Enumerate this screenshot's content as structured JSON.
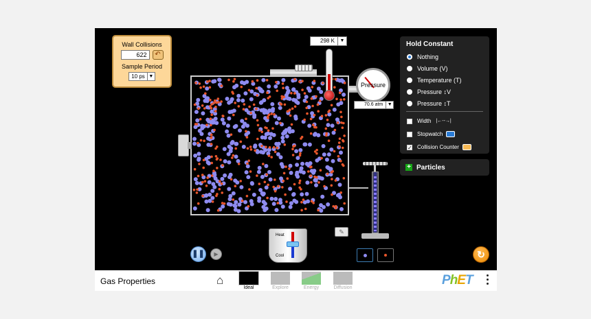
{
  "collision_panel": {
    "title": "Wall Collisions",
    "count": "622",
    "reset_icon": "undo-icon",
    "sample_label": "Sample Period",
    "sample_value": "10 ps"
  },
  "thermometer": {
    "value": "298 K"
  },
  "gauge": {
    "label": "Pressure",
    "value": "70.6 atm"
  },
  "hold_constant": {
    "title": "Hold Constant",
    "options": [
      {
        "label": "Nothing",
        "selected": true
      },
      {
        "label": "Volume (V)",
        "selected": false
      },
      {
        "label": "Temperature (T)",
        "selected": false
      },
      {
        "label": "Pressure ↕V",
        "selected": false
      },
      {
        "label": "Pressure ↕T",
        "selected": false
      }
    ],
    "checks": [
      {
        "label": "Width",
        "suffix": "|←--→|",
        "checked": false
      },
      {
        "label": "Stopwatch",
        "checked": false,
        "icon": "stopwatch-icon"
      },
      {
        "label": "Collision Counter",
        "checked": true,
        "icon": "collision-counter-icon"
      }
    ]
  },
  "particles_panel": {
    "label": "Particles"
  },
  "heater": {
    "heat_label": "Heat",
    "cool_label": "Cool"
  },
  "colors": {
    "heavy": "#8e8bf0",
    "light": "#e8562b",
    "panel_bg": "#222222",
    "accent": "#2a7cd6"
  },
  "navbar": {
    "app_title": "Gas Properties",
    "screens": [
      {
        "label": "Ideal",
        "active": true
      },
      {
        "label": "Explore",
        "active": false
      },
      {
        "label": "Energy",
        "active": false
      },
      {
        "label": "Diffusion",
        "active": false
      }
    ],
    "logo": "PhET"
  }
}
